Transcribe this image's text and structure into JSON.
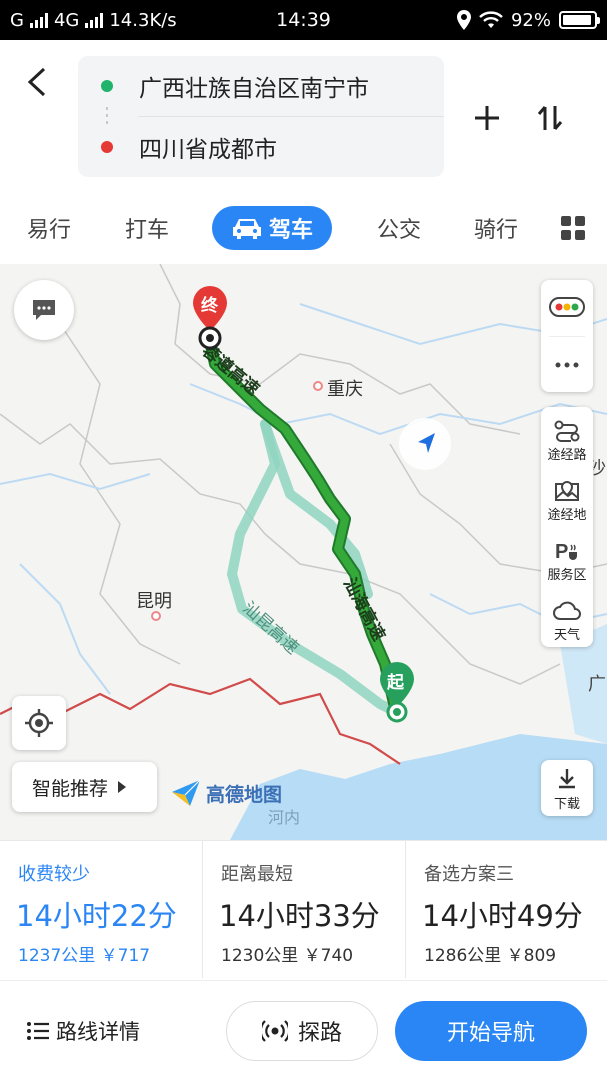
{
  "status_bar": {
    "carrier": "G",
    "network": "4G",
    "speed": "14.3K/s",
    "time": "14:39",
    "battery": "92%",
    "battery_level": 0.92,
    "icons": [
      "signal-icon",
      "location-icon",
      "wifi-icon",
      "battery-icon"
    ]
  },
  "route": {
    "origin": "广西壮族自治区南宁市",
    "destination": "四川省成都市",
    "origin_color": "#1fb36b",
    "destination_color": "#e53935"
  },
  "modes": {
    "items": [
      "易行",
      "打车",
      "驾车",
      "公交",
      "骑行"
    ],
    "active": "驾车"
  },
  "map": {
    "end_marker": "终",
    "start_marker": "起",
    "cities": [
      "重庆",
      "昆明"
    ],
    "roads": [
      "蓉遵高速",
      "汕海高速",
      "汕昆高速"
    ],
    "provider": "高德地图",
    "watermark": "河内",
    "edge_labels": [
      "沙",
      "广"
    ],
    "side_tools": [
      "途经路",
      "途经地",
      "服务区",
      "天气"
    ],
    "download_label": "下载",
    "smart_recommend": "智能推荐",
    "route_color": "#35a93a",
    "alt_route_color": "#8fd4c0"
  },
  "options": [
    {
      "tag": "收费较少",
      "time": "14小时22分",
      "info": "1237公里 ￥717"
    },
    {
      "tag": "距离最短",
      "time": "14小时33分",
      "info": "1230公里 ￥740"
    },
    {
      "tag": "备选方案三",
      "time": "14小时49分",
      "info": "1286公里 ￥809"
    }
  ],
  "bottom": {
    "details": "路线详情",
    "explore": "探路",
    "navigate": "开始导航"
  },
  "accent_color": "#2a86f4"
}
